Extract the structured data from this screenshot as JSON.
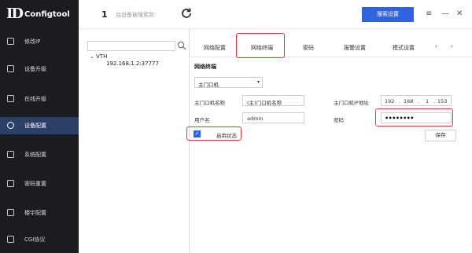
{
  "app": {
    "logo_mark": "ID",
    "title": "Configtool"
  },
  "header": {
    "device_count": "1",
    "device_count_text": "台设备被搜索到",
    "search_button": "搜索设置",
    "window_controls": {
      "menu": "≡",
      "minimize": "—",
      "close": "✕"
    }
  },
  "sidebar": {
    "items": [
      {
        "label": "修改IP",
        "icon": "edit-icon"
      },
      {
        "label": "设备升级",
        "icon": "upgrade-icon"
      },
      {
        "label": "在线升级",
        "icon": "cloud-upgrade-icon"
      },
      {
        "label": "设备配置",
        "icon": "settings-icon",
        "active": true
      },
      {
        "label": "系统配置",
        "icon": "system-icon"
      },
      {
        "label": "密码重置",
        "icon": "password-icon"
      },
      {
        "label": "楼宇配置",
        "icon": "building-icon"
      },
      {
        "label": "CGI协议",
        "icon": "cgi-icon"
      }
    ]
  },
  "device_tree": {
    "search_placeholder": "",
    "root": "VTH",
    "child": "192.168.1.2:37777"
  },
  "tabs": [
    {
      "label": "网络配置"
    },
    {
      "label": "网络终端",
      "active": true
    },
    {
      "label": "密码"
    },
    {
      "label": "报警设置"
    },
    {
      "label": "模式设置"
    }
  ],
  "tab_arrows": {
    "prev": "‹",
    "next": "›"
  },
  "section": {
    "title": "网络终端",
    "select_value": "主门口机",
    "main_door_name_label": "主门口机名称",
    "main_door_name_value": "(主)门口机名称",
    "main_door_ip_label": "主门口机IP地址",
    "ip": [
      "192",
      "168",
      "1",
      "153"
    ],
    "username_label": "用户名",
    "username_value": "admin",
    "password_label": "密码",
    "password_value": "••••••••",
    "enable_label": "启用状态",
    "enable_checked": "✓",
    "save_button": "保存"
  },
  "colors": {
    "accent": "#2f63e0",
    "sidebar_bg": "#1a1c22",
    "sidebar_active": "#2c3f66",
    "highlight": "#e23a3a"
  }
}
